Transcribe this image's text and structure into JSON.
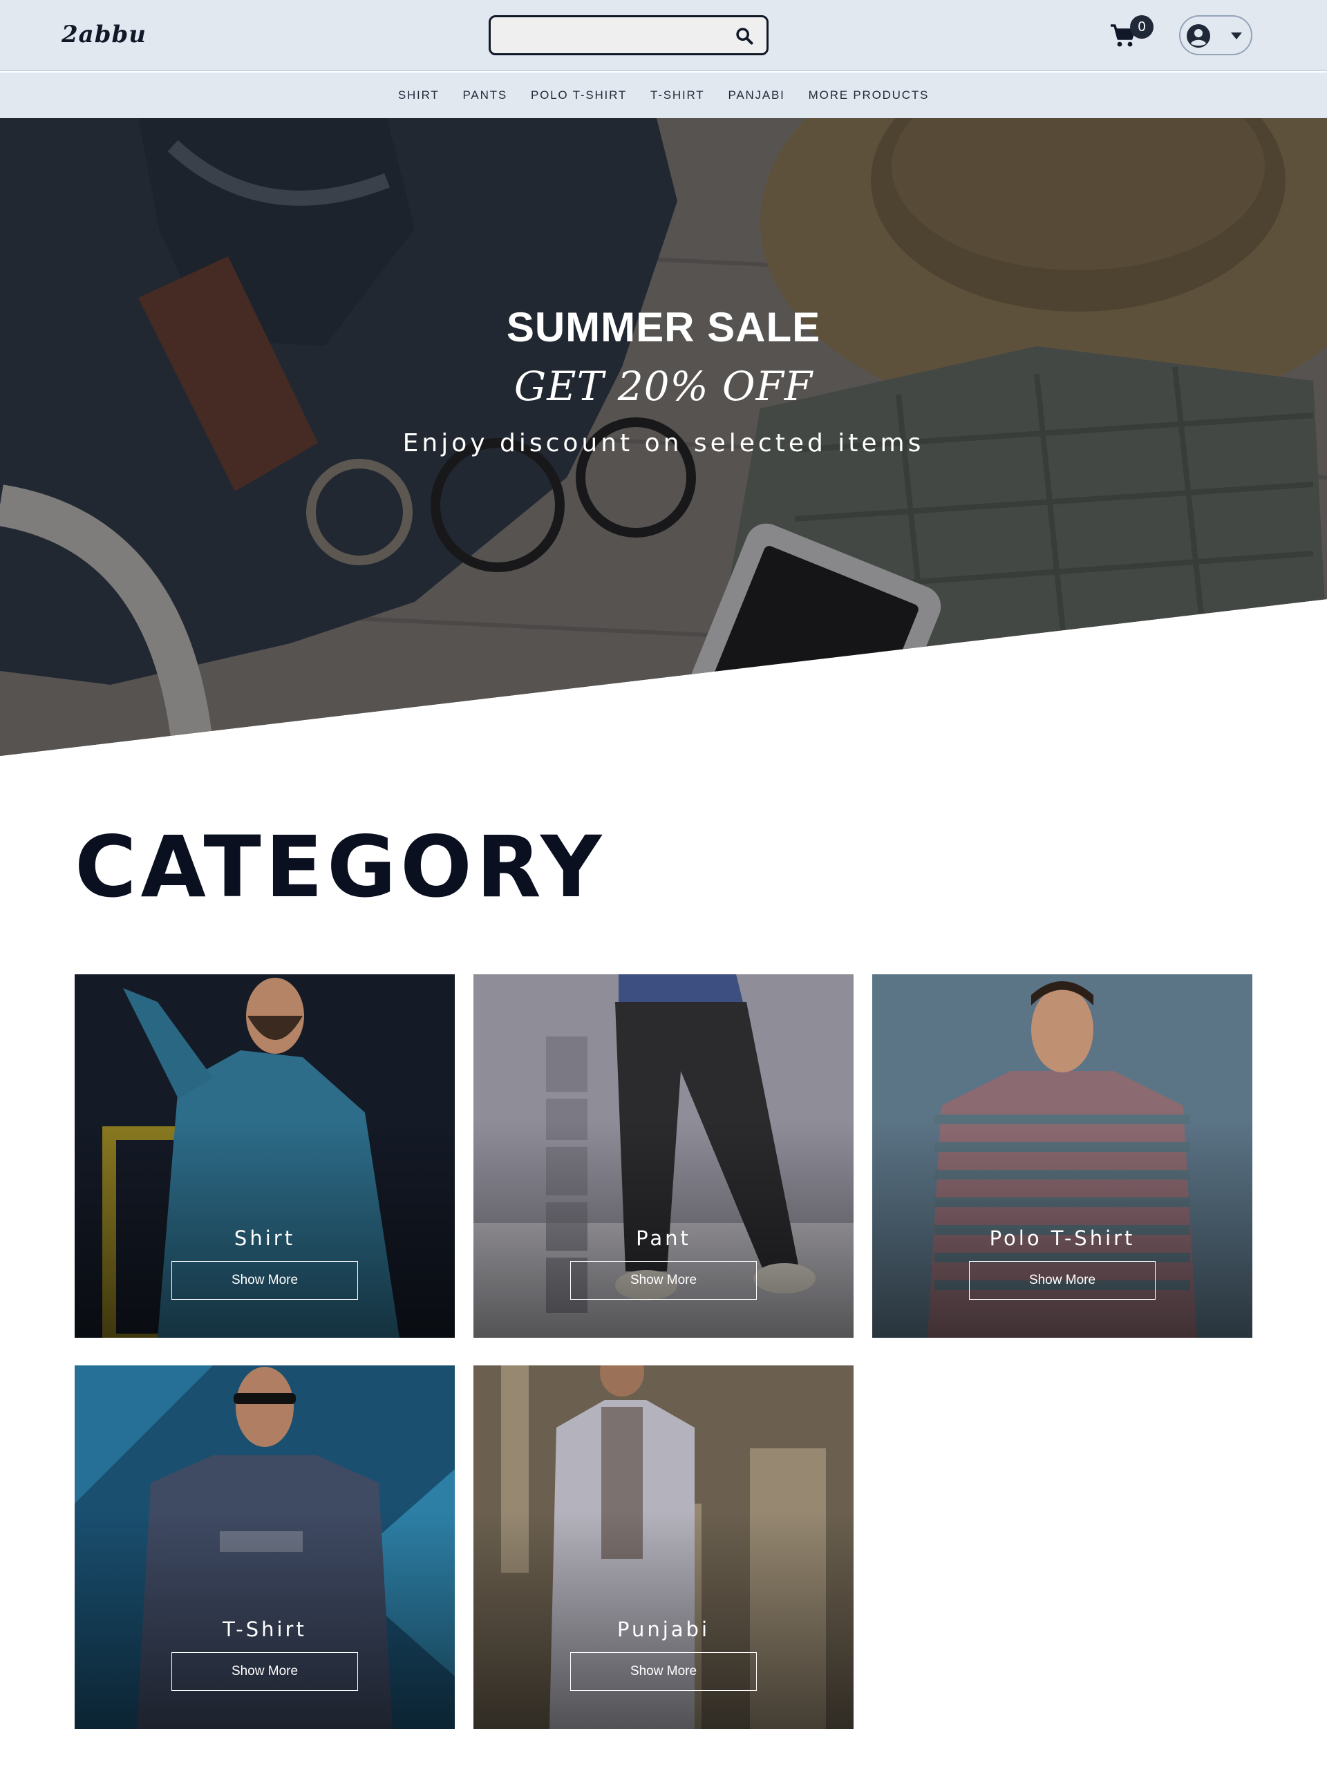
{
  "brand": {
    "logo": "2abbu"
  },
  "search": {
    "placeholder": "",
    "value": "",
    "icon": "search-icon"
  },
  "cart": {
    "count": "0",
    "icon": "cart-icon"
  },
  "account": {
    "icon": "user-circle-icon",
    "caret_icon": "caret-down-icon"
  },
  "nav": {
    "items": [
      {
        "label": "SHIRT"
      },
      {
        "label": "PANTS"
      },
      {
        "label": "POLO T-SHIRT"
      },
      {
        "label": "T-SHIRT"
      },
      {
        "label": "PANJABI"
      },
      {
        "label": "MORE PRODUCTS"
      }
    ]
  },
  "hero": {
    "title": "SUMMER SALE",
    "subtitle": "GET 20% OFF",
    "description": "Enjoy discount on selected items"
  },
  "category": {
    "title": "CATEGORY",
    "cards": [
      {
        "label": "Shirt",
        "button": "Show More"
      },
      {
        "label": "Pant",
        "button": "Show More"
      },
      {
        "label": "Polo T-Shirt",
        "button": "Show More"
      },
      {
        "label": "T-Shirt",
        "button": "Show More"
      },
      {
        "label": "Punjabi",
        "button": "Show More"
      }
    ]
  },
  "colors": {
    "header_bg": "#e2e8f0",
    "text_dark": "#0b1020",
    "badge_bg": "#1f2937"
  }
}
